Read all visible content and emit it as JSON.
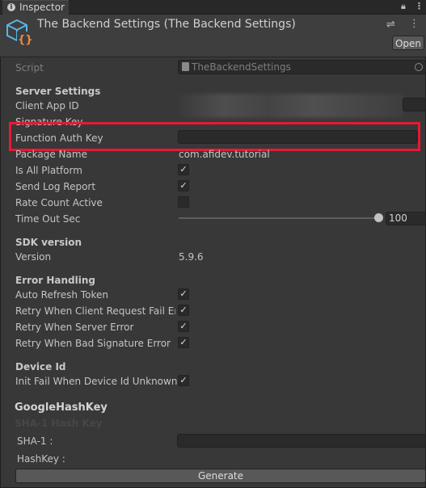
{
  "window": {
    "tab_label": "Inspector"
  },
  "header": {
    "title": "The Backend Settings (The Backend Settings)",
    "open_label": "Open"
  },
  "script": {
    "label": "Script",
    "value": "TheBackendSettings"
  },
  "server_settings": {
    "heading": "Server Settings",
    "client_app_id_label": "Client App ID",
    "signature_key_label": "Signature Key",
    "function_auth_key_label": "Function Auth Key",
    "function_auth_key_value": "",
    "package_name_label": "Package Name",
    "package_name_value": "com.afidev.tutorial",
    "is_all_platform_label": "Is All Platform",
    "is_all_platform": true,
    "send_log_report_label": "Send Log Report",
    "send_log_report": true,
    "rate_count_active_label": "Rate Count Active",
    "rate_count_active": false,
    "time_out_sec_label": "Time Out Sec",
    "time_out_sec_value": "100"
  },
  "sdk_version": {
    "heading": "SDK version",
    "version_label": "Version",
    "version_value": "5.9.6"
  },
  "error_handling": {
    "heading": "Error Handling",
    "auto_refresh_token_label": "Auto Refresh Token",
    "retry_client_request_fail_label": "Retry When Client Request Fail Erro",
    "retry_server_error_label": "Retry When Server Error",
    "retry_bad_signature_label": "Retry When Bad Signature Error"
  },
  "device_id": {
    "heading": "Device Id",
    "init_fail_label": "Init Fail When Device Id Unknown"
  },
  "google_hash_key": {
    "heading": "GoogleHashKey",
    "sub_heading": "SHA-1 Hash Key",
    "sha1_label": "SHA-1 :",
    "hashkey_label": "HashKey :",
    "generate_label": "Generate"
  },
  "colors": {
    "highlight": "#e81933",
    "background": "#383838",
    "field": "#2a2a2a"
  },
  "icons": [
    "info-icon",
    "lock-icon",
    "more-icon",
    "script-asset-icon",
    "settings-icon",
    "target-icon",
    "checkmark-icon"
  ]
}
